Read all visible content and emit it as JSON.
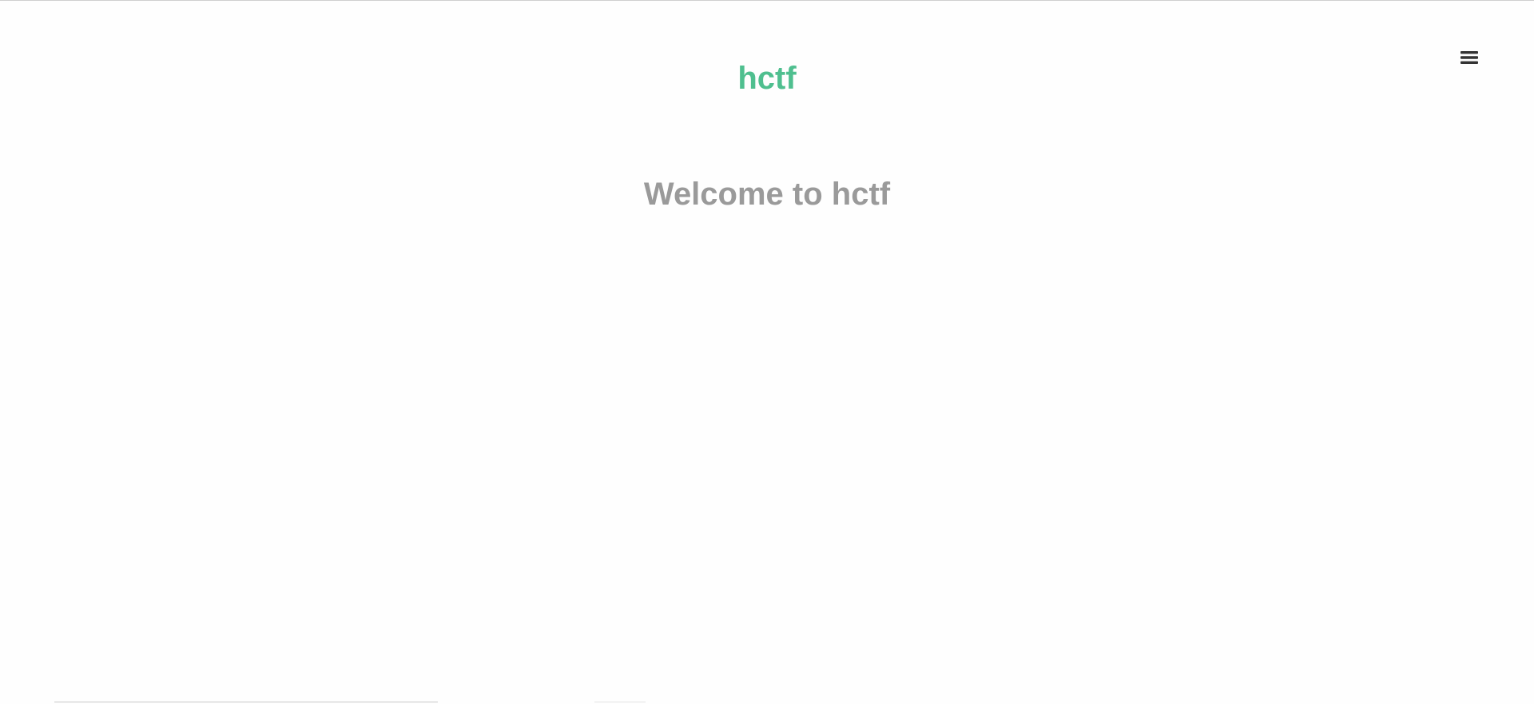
{
  "header": {
    "brand": "hctf",
    "menu_icon": "hamburger-menu-icon"
  },
  "main": {
    "welcome": "Welcome to hctf"
  },
  "colors": {
    "brand": "#4fbf8f",
    "welcome_text": "#9a9a9a",
    "menu_icon": "#333333"
  }
}
